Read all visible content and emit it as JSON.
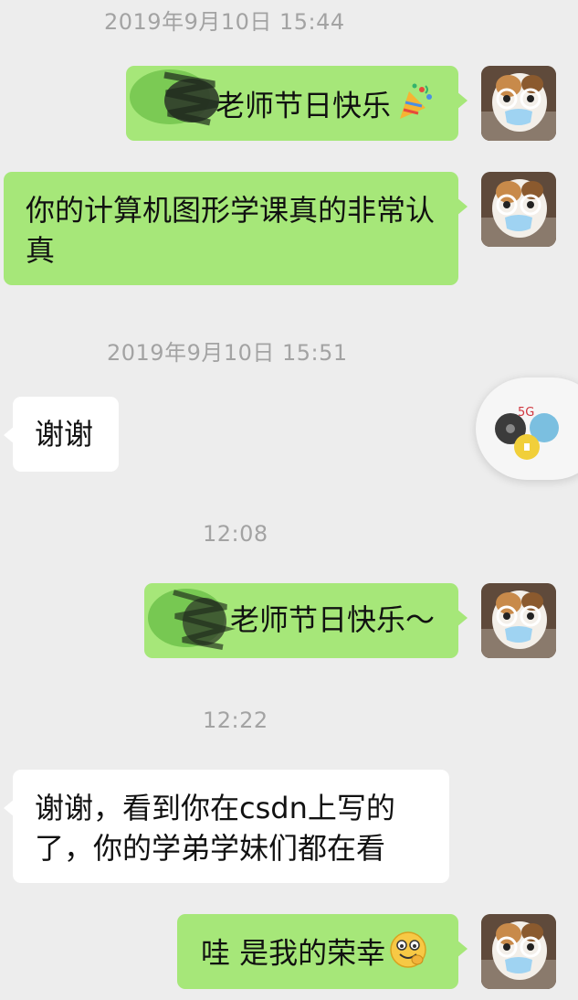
{
  "timestamps": [
    "2019年9月10日 15:44",
    "2019年9月10日 15:51",
    "12:08",
    "12:22"
  ],
  "messages": [
    {
      "text": "老师节日快乐",
      "emoji": "party-popper-icon"
    },
    {
      "text": "你的计算机图形学课真的非常认真"
    },
    {
      "text": "谢谢"
    },
    {
      "text": "老师节日快乐～"
    },
    {
      "text": "谢谢，看到你在csdn上写的了，你的学弟学妹们都在看"
    },
    {
      "text": "哇 是我的荣幸",
      "emoji": "grinning-face-icon"
    }
  ],
  "float_ball": {
    "badge": "5G"
  },
  "colors": {
    "background": "#ededed",
    "sent_bubble": "#a6e779",
    "received_bubble": "#ffffff",
    "timestamp": "#a3a3a3"
  }
}
